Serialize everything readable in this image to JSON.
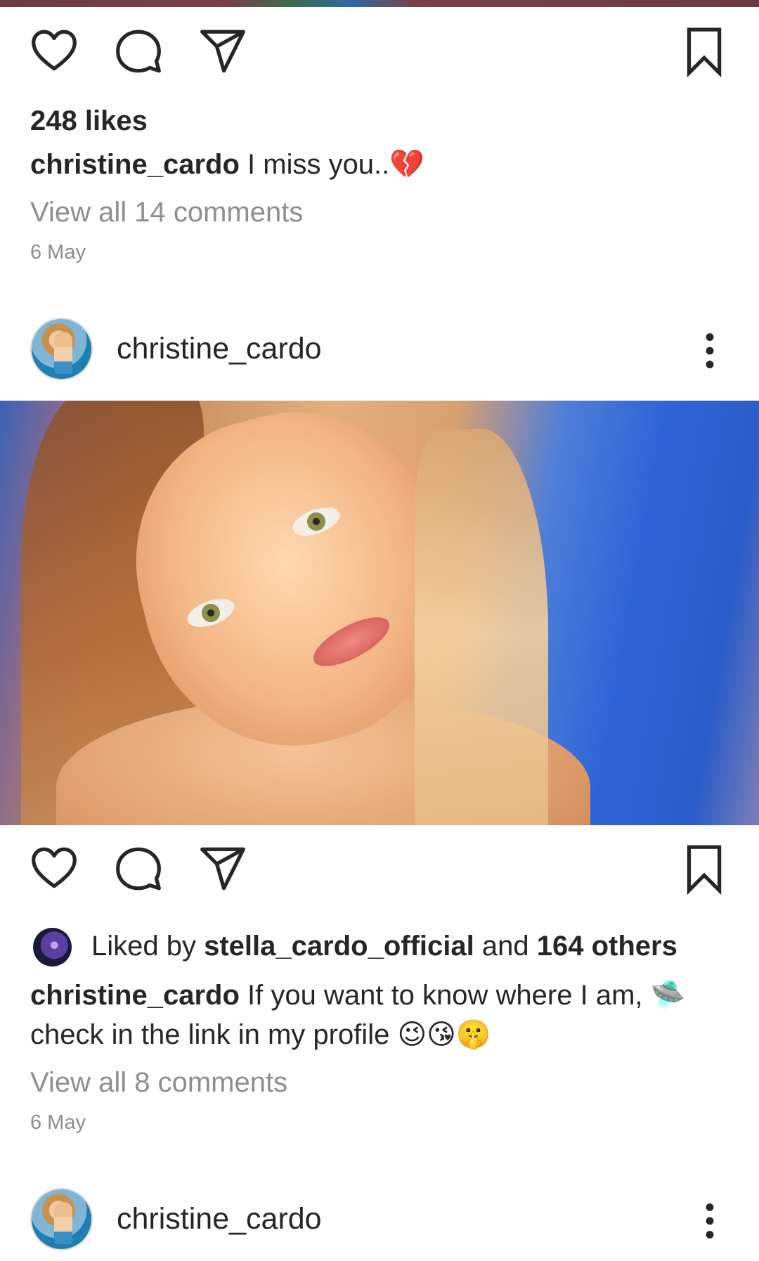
{
  "post1": {
    "likes": "248 likes",
    "caption_user": "christine_cardo",
    "caption_text": "I miss you..",
    "caption_emoji": "💔",
    "view_comments": "View all 14 comments",
    "date": "6 May"
  },
  "post2": {
    "header_username": "christine_cardo",
    "liked_by_prefix": "Liked by",
    "liked_by_user": "stella_cardo_official",
    "liked_by_and": "and",
    "liked_by_others": "164 others",
    "caption_user": "christine_cardo",
    "caption_text_line1": "If you want to know where I am,",
    "caption_emoji_1": "🛸",
    "caption_text_line2": "check in the link in my profile",
    "caption_emoji_2": "😉😘🤫",
    "view_comments": "View all 8 comments",
    "date": "6 May"
  },
  "post3": {
    "header_username": "christine_cardo"
  },
  "icons": {
    "like": "heart-icon",
    "comment": "comment-bubble-icon",
    "share": "paper-plane-icon",
    "save": "bookmark-icon",
    "more": "vertical-ellipsis-icon"
  },
  "colors": {
    "text": "#262626",
    "secondary_text": "#8e8e8e",
    "background": "#ffffff"
  }
}
